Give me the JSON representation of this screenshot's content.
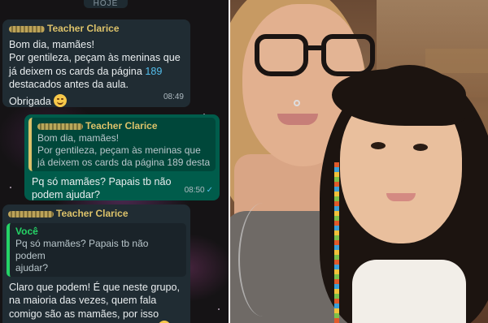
{
  "chat": {
    "date_label": "HOJE",
    "messages": [
      {
        "type": "incoming",
        "sender": "Teacher Clarice",
        "text_lines": [
          "Bom dia, mamães!",
          "Por gentileza, peçam às meninas que",
          "já deixem os cards da página "
        ],
        "link_text": "189",
        "text_after": "destacados antes da aula.",
        "closing": "Obrigada",
        "emoji": "smiling-face-emoji",
        "time": "08:49"
      },
      {
        "type": "outgoing",
        "quote": {
          "sender": "Teacher Clarice",
          "lines": [
            "Bom dia, mamães!",
            "Por gentileza, peçam às meninas que",
            "já deixem os cards da página 189 desta..."
          ]
        },
        "text": "Pq só mamães? Papais tb não\npodem ajudar?",
        "time": "08:50",
        "status_icon": "read-checkmark-icon"
      },
      {
        "type": "incoming",
        "sender": "Teacher Clarice",
        "quote": {
          "sender": "Você",
          "lines": [
            "Pq só mamães? Papais tb não podem",
            "ajudar?"
          ]
        },
        "text": "Claro que podem! É que neste grupo,\nna maioria das vezes, quem fala\ncomigo são as mamães, por isso\nescrevi assim nas últimas vezes",
        "emoji": "smiling-face-emoji"
      }
    ]
  },
  "photo": {
    "subject": "selfie-photo"
  },
  "colors": {
    "chat_bg": "#151315",
    "incoming_bubble": "#202c33",
    "outgoing_bubble": "#005c4b",
    "sender_name": "#dcc26a",
    "you_name": "#25d366",
    "link": "#53bdeb"
  }
}
